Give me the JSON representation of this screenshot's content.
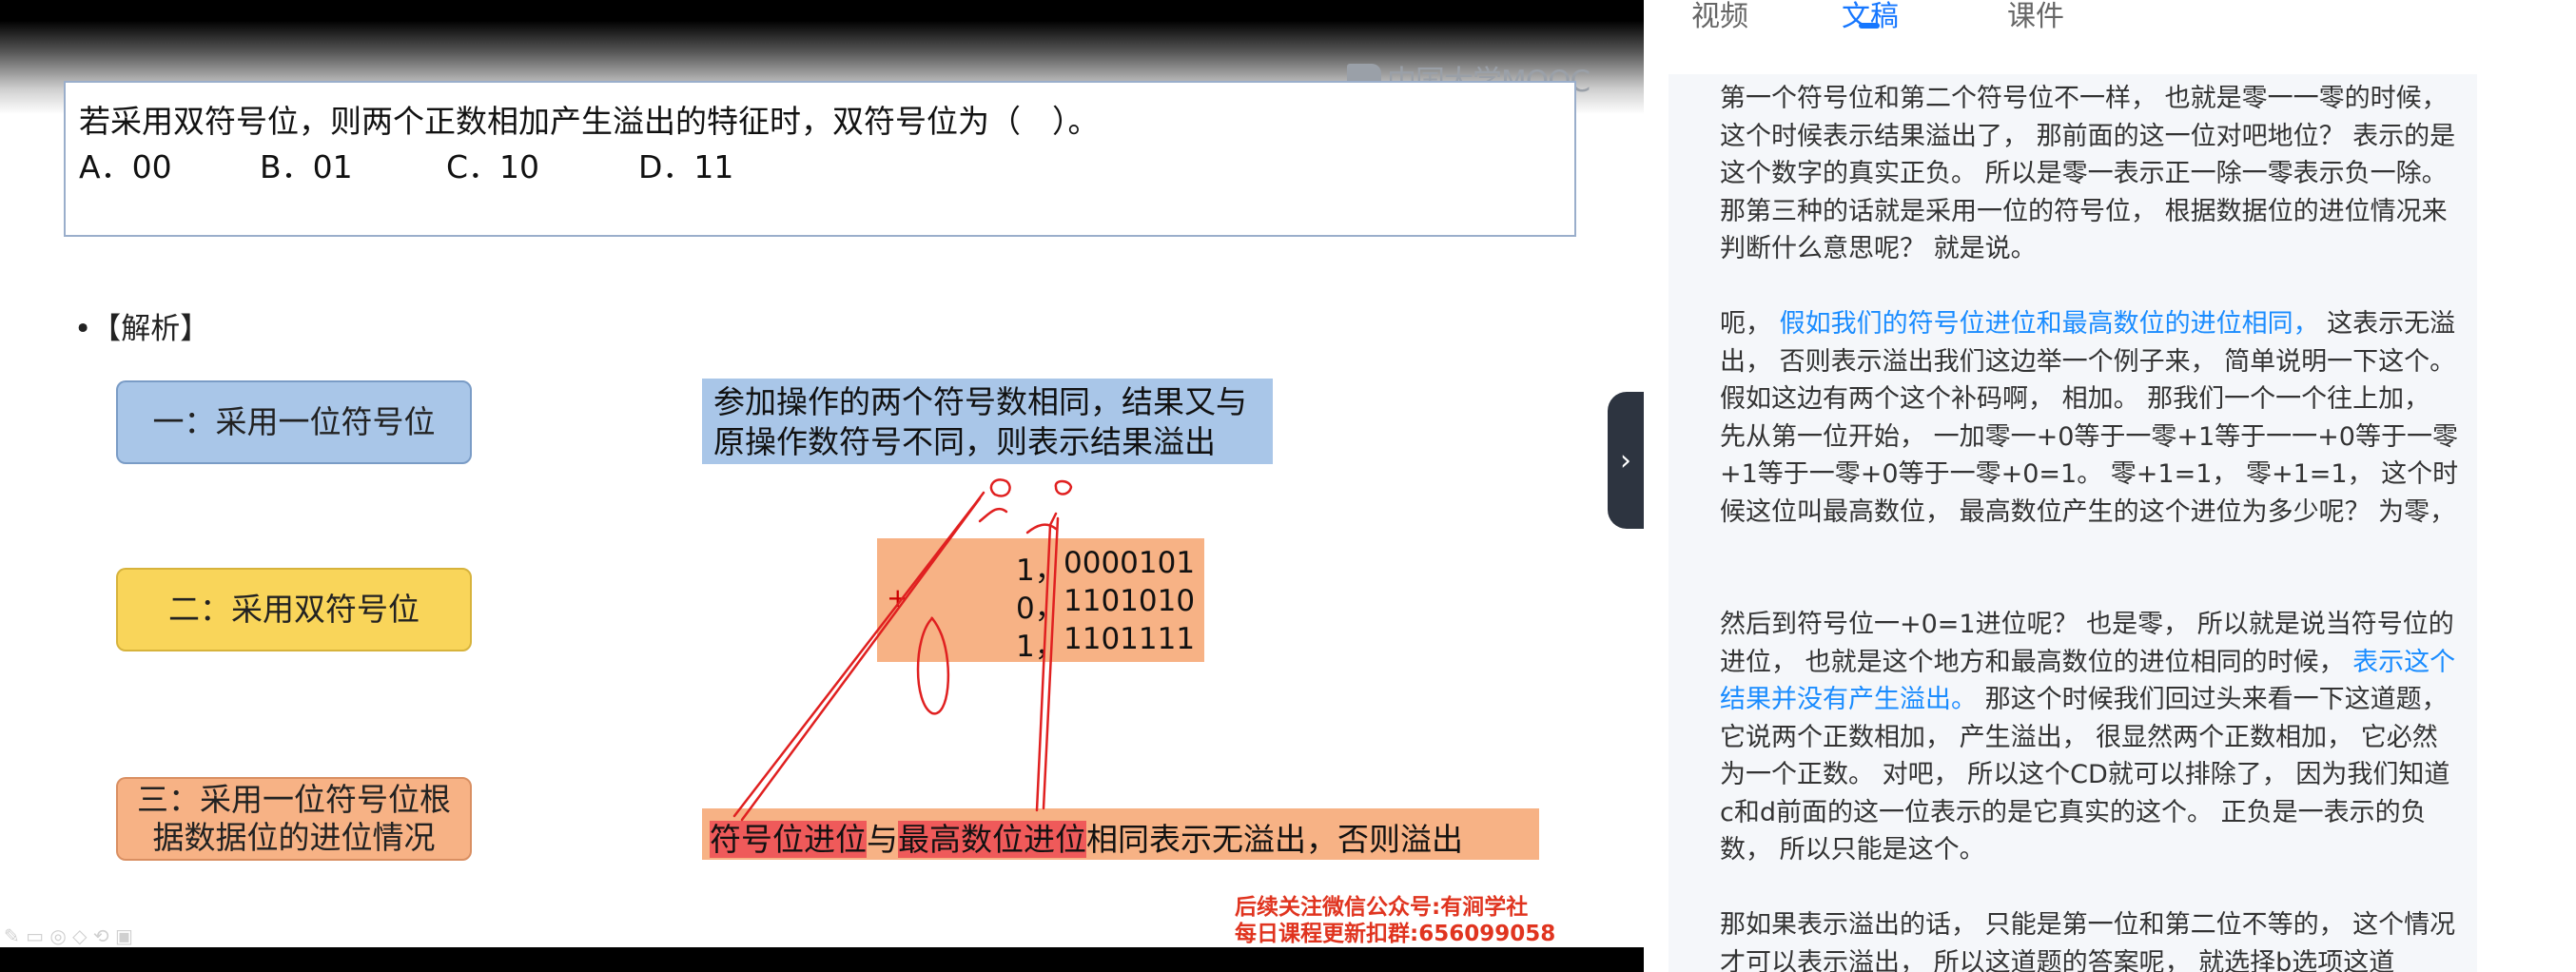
{
  "video": {
    "logo_text": "中国大学MOOC",
    "question": "若采用双符号位，则两个正数相加产生溢出的特征时，双符号位为（　）。",
    "options": [
      "A．00",
      "B．01",
      "C．10",
      "D．11"
    ],
    "analysis_label": "•【解析】",
    "methods": [
      "一：采用一位符号位",
      "二：采用双符号位",
      "三：采用一位符号位根据数据位的进位情况"
    ],
    "rule_text": "参加操作的两个符号数相同，结果又与原操作数符号不同，则表示结果溢出",
    "calc": {
      "rows": [
        {
          "sign": "1，",
          "bits": "0000101"
        },
        {
          "sign": "0，",
          "bits": "1101010"
        },
        {
          "sign": "1，",
          "bits": "1101111"
        }
      ],
      "plus": "+"
    },
    "conclusion": {
      "part1": "符号位进位",
      "part2": "与",
      "part3": "最高数位进位",
      "part4": "相同表示无溢出，否则溢出"
    },
    "promo": [
      "后续关注微信公众号:有涧学社",
      "每日课程更新扣群:656099058"
    ]
  },
  "panel": {
    "tabs": [
      "视频",
      "文稿",
      "课件"
    ],
    "active_tab": "文稿",
    "collapse_icon": "chevron-right-icon",
    "paragraphs": [
      {
        "a": "第一个符号位和第二个符号位不一样， 也就是零一一零的时候， 这个时候表示结果溢出了， 那前面的这一位对吧地位？ 表示的是这个数字的真实正负。 所以是零一表示正一除一零表示负一除。 那第三种的话就是采用一位的符号位， 根据数据位的进位情况来判断什么意思呢？ 就是说。"
      },
      {
        "a": "呃， ",
        "link": "假如我们的符号位进位和最高数位的进位相同，",
        "b": " 这表示无溢出， 否则表示溢出我们这边举一个例子来， 简单说明一下这个。 假如这边有两个这个补码啊， 相加。 那我们一个一个往上加， 先从第一位开始， 一加零一+0等于一零+1等于一一+0等于一零+1等于一零+0等于一零+0=1。 零+1=1， 零+1=1， 这个时候这位叫最高数位， 最高数位产生的这个进位为多少呢？ 为零，"
      },
      {
        "a": "然后到符号位一+0=1进位呢？ 也是零， 所以就是说当符号位的进位， 也就是这个地方和最高数位的进位相同的时候， ",
        "link": "表示这个结果并没有产生溢出。",
        "b": " 那这个时候我们回过头来看一下这道题， 它说两个正数相加， 产生溢出， 很显然两个正数相加， 它必然为一个正数。 对吧， 所以这个CD就可以排除了， 因为我们知道c和d前面的这一位表示的是它真实的这个。 正负是一表示的负数， 所以只能是这个。"
      },
      {
        "a": "那如果表示溢出的话， 只能是第一位和第二位不等的， 这个情况才可以表示溢出， 所以这道题的答案呢， 就选择b选项这道"
      }
    ]
  },
  "colors": {
    "accent": "#1677ff",
    "link": "#1a8cff",
    "method1": "#a9c6e8",
    "method2": "#f9d55a",
    "method3": "#f7b285",
    "annotation": "#e02020",
    "promo": "#e0341f"
  }
}
